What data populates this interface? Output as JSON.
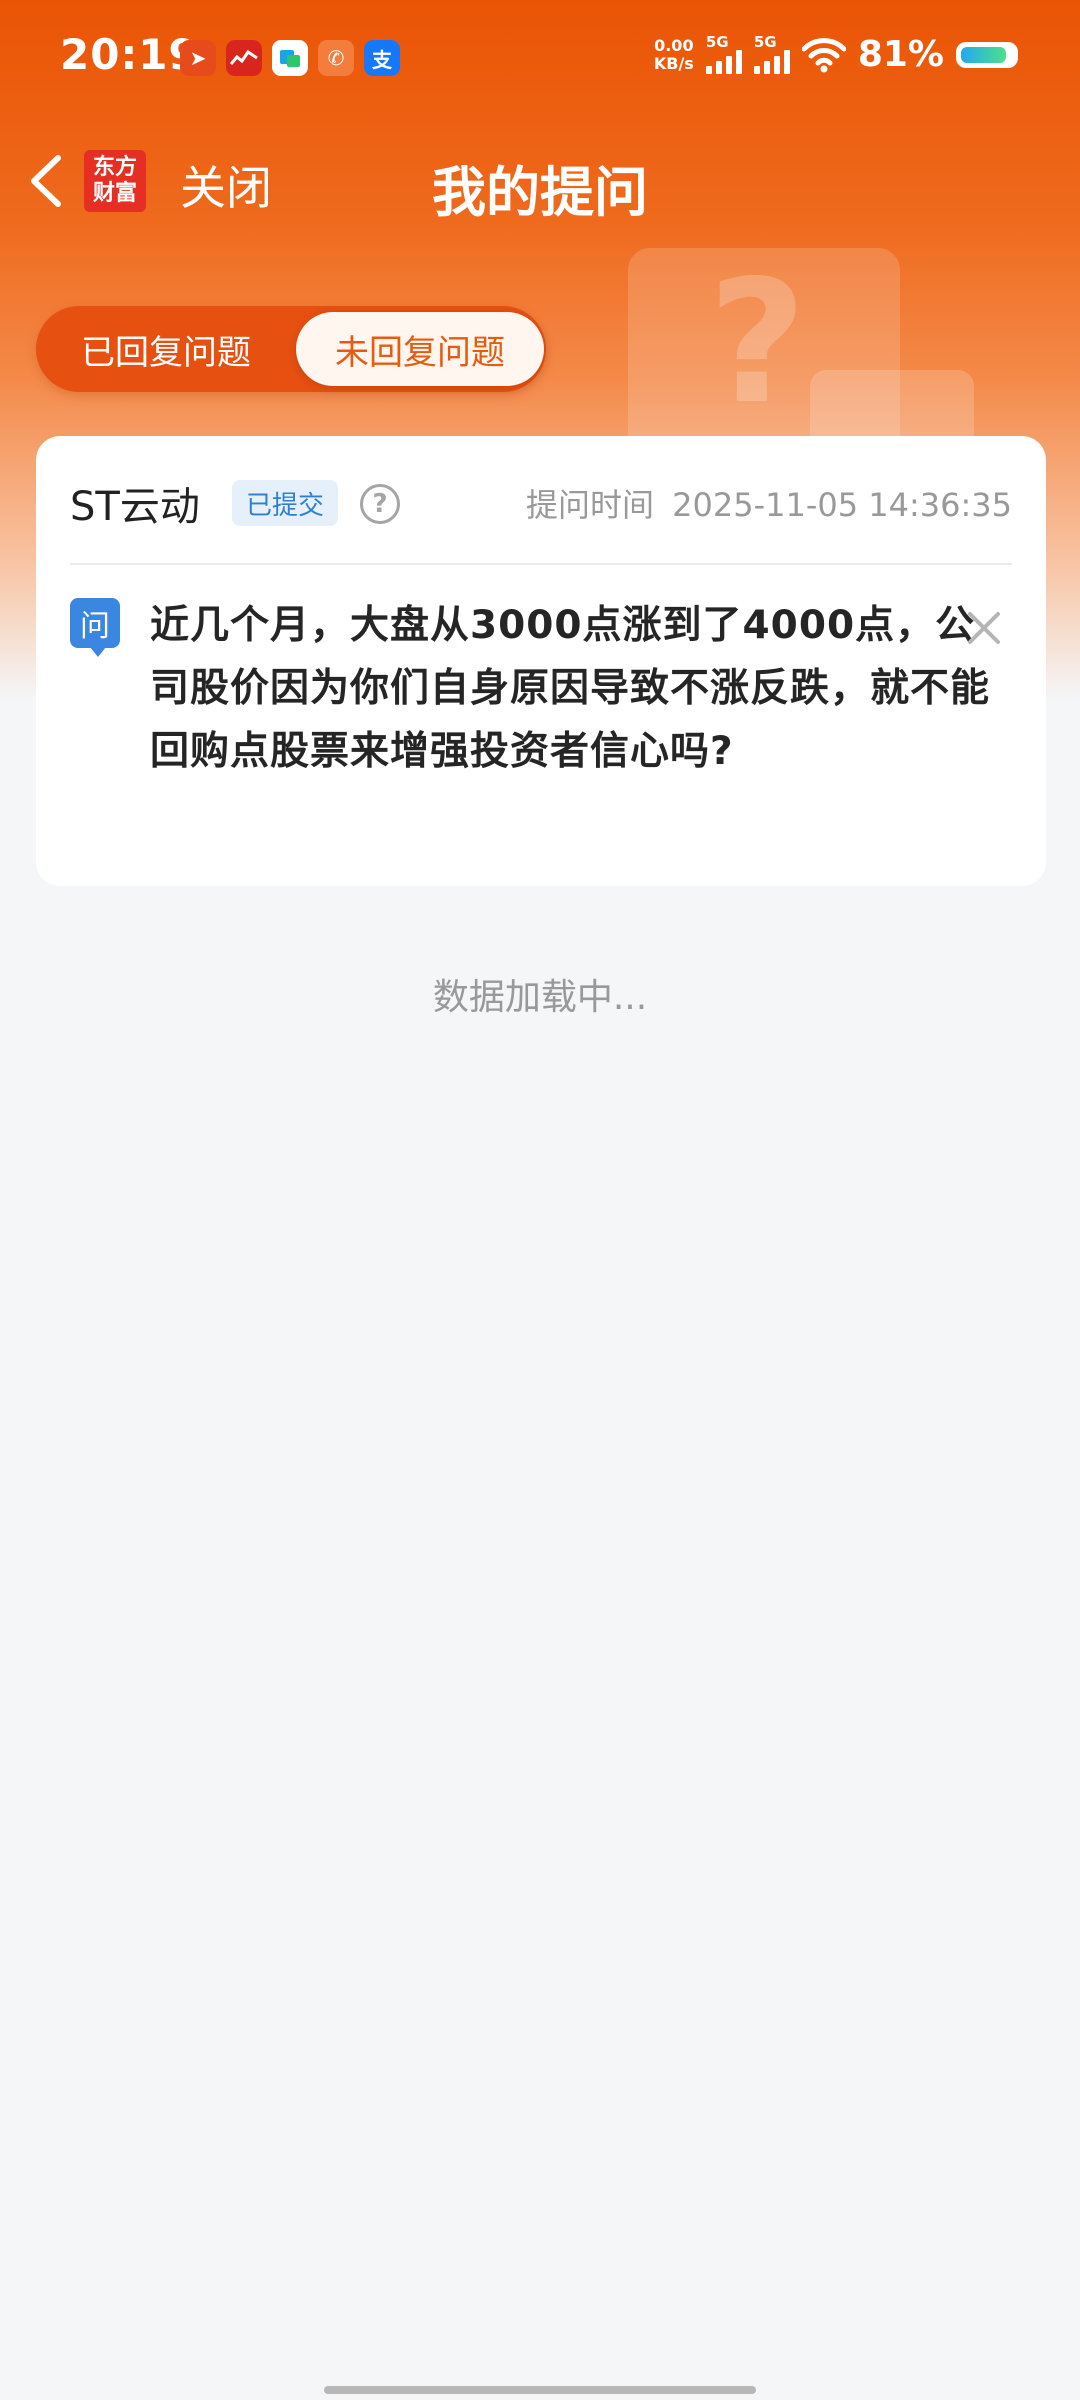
{
  "status_bar": {
    "time": "20:19",
    "net_speed_value": "0.00",
    "net_speed_unit": "KB/s",
    "signal1_label": "5G",
    "signal2_label": "5G",
    "battery_pct": "81%",
    "battery_level": 0.81,
    "notification_icons": [
      "send-icon",
      "stock-chart-app-icon",
      "camera-app-icon",
      "phone-app-icon",
      "alipay-icon"
    ]
  },
  "nav": {
    "logo_line1": "东方",
    "logo_line2": "财富",
    "close_label": "关闭",
    "title": "我的提问"
  },
  "tabs": [
    {
      "label": "已回复问题",
      "selected": false
    },
    {
      "label": "未回复问题",
      "selected": true
    }
  ],
  "question_card": {
    "stock_name": "ST云动",
    "status": "已提交",
    "help_glyph": "?",
    "time_label": "提问时间",
    "time_value": "2025-11-05 14:36:35",
    "q_badge": "问",
    "question_text": "近几个月，大盘从3000点涨到了4000点，公司股价因为你们自身原因导致不涨反跌，就不能回购点股票来增强投资者信心吗?"
  },
  "loading_text": "数据加载中...",
  "colors": {
    "brand_orange": "#ea5405",
    "badge_blue": "#3b86e0",
    "tab_active_text": "#e85a10"
  }
}
